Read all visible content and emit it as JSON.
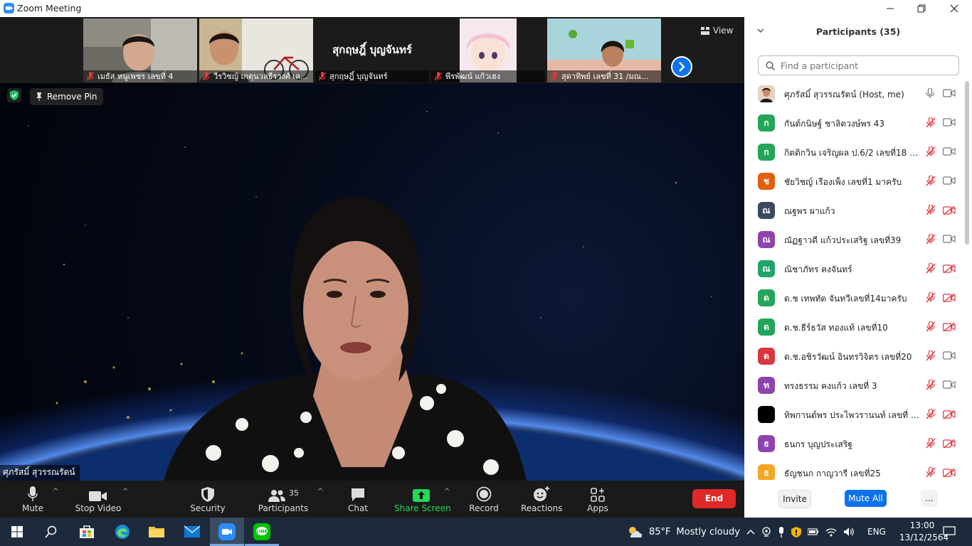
{
  "window": {
    "title": "Zoom Meeting"
  },
  "gallery": {
    "tiles": [
      {
        "name": "เมธัส  หนูเพชร เลขที่ 4",
        "kind": "video",
        "scene": "boy"
      },
      {
        "name": "วีรวิชญ์ เกตุนวลธีรวงศ์ เล...",
        "kind": "video",
        "scene": "boybike"
      },
      {
        "name": "สุกฤษฎิ์ บุญจันทร์",
        "kind": "name",
        "display": "สุกฤษฎิ์ บุญจันทร์"
      },
      {
        "name": "พีรพัฒน์ แก้วเฮง",
        "kind": "video",
        "scene": "anime"
      },
      {
        "name": "สุดาทิพย์ เลขที่ 31 /มณ...",
        "kind": "video",
        "scene": "girl"
      }
    ],
    "view_label": "View"
  },
  "main": {
    "remove_pin": "Remove Pin",
    "speaker_name": "ศุภรัสมิ์ สุวรรณรัตน์"
  },
  "toolbar": {
    "mute": "Mute",
    "stop_video": "Stop Video",
    "security": "Security",
    "participants": "Participants",
    "participants_count": "35",
    "chat": "Chat",
    "share_screen": "Share Screen",
    "record": "Record",
    "reactions": "Reactions",
    "apps": "Apps",
    "end": "End"
  },
  "panel": {
    "title": "Participants (35)",
    "search_placeholder": "Find a participant",
    "invite": "Invite",
    "mute_all": "Mute All",
    "more": "...",
    "participants": [
      {
        "initial": "",
        "name": "ศุภรัสมิ์ สุวรรณรัตน์ (Host, me)",
        "color": "#c98a6a",
        "muted": false,
        "video": true,
        "photo": true
      },
      {
        "initial": "ก",
        "name": "กันต์กนิษฐ์ ชาลิตวงษ์พร 43",
        "color": "#23a55a",
        "muted": true,
        "video": true
      },
      {
        "initial": "ก",
        "name": "กิตติกวิน เจริญผล ป.6/2 เลขที่18 โก...",
        "color": "#23a55a",
        "muted": true,
        "video": true
      },
      {
        "initial": "ช",
        "name": "ชัยวิชญ์ เรืองเพ็ง เลขที่1 มาครับ",
        "color": "#e0600e",
        "muted": true,
        "video": true
      },
      {
        "initial": "ณ",
        "name": "ณฐพร  ผาแก้ว",
        "color": "#3a4a5e",
        "muted": true,
        "video": false
      },
      {
        "initial": "ณ",
        "name": "ณัฏฐาวดี แก้วประเสริฐ เลขที่39",
        "color": "#8e44ad",
        "muted": true,
        "video": true
      },
      {
        "initial": "ณ",
        "name": "ณิชาภัทร คงจันทร์",
        "color": "#1fa46a",
        "muted": true,
        "video": false
      },
      {
        "initial": "ด",
        "name": "ด.ช เทพทัต จันทวีเลขที่14มาครับ",
        "color": "#23a55a",
        "muted": true,
        "video": false
      },
      {
        "initial": "ด",
        "name": "ด.ช.ธีร์ธวัส ทองแท้ เลขที่10",
        "color": "#23a55a",
        "muted": true,
        "video": false
      },
      {
        "initial": "ด",
        "name": "ด.ช.อชิรวัฒน์ อินทรวิจิตร  เลขที่20",
        "color": "#d9363e",
        "muted": true,
        "video": true
      },
      {
        "initial": "ท",
        "name": "ทรงธรรม คงแก้ว เลขที่ 3",
        "color": "#8e44ad",
        "muted": true,
        "video": true
      },
      {
        "initial": "",
        "name": "ทิพกานต์พร ประไพวรานนท์ เลขที่ 30...",
        "color": "#000000",
        "muted": true,
        "video": false
      },
      {
        "initial": "ธ",
        "name": "ธนกร บุญประเสริฐ",
        "color": "#8e44ad",
        "muted": true,
        "video": false
      },
      {
        "initial": "ธ",
        "name": "ธัญชนก กาญวารี เลขที่25",
        "color": "#f5a623",
        "muted": true,
        "video": false
      }
    ]
  },
  "taskbar": {
    "weather_temp": "85°F",
    "weather_desc": "Mostly cloudy",
    "lang": "ENG",
    "time": "13:00",
    "date": "13/12/2564",
    "apps": [
      "start",
      "search",
      "store",
      "edge",
      "explorer",
      "mail",
      "zoom",
      "line"
    ]
  },
  "colors": {
    "accent": "#0e72ed",
    "end": "#e02828",
    "share": "#23d959",
    "muted": "#e0383e"
  }
}
